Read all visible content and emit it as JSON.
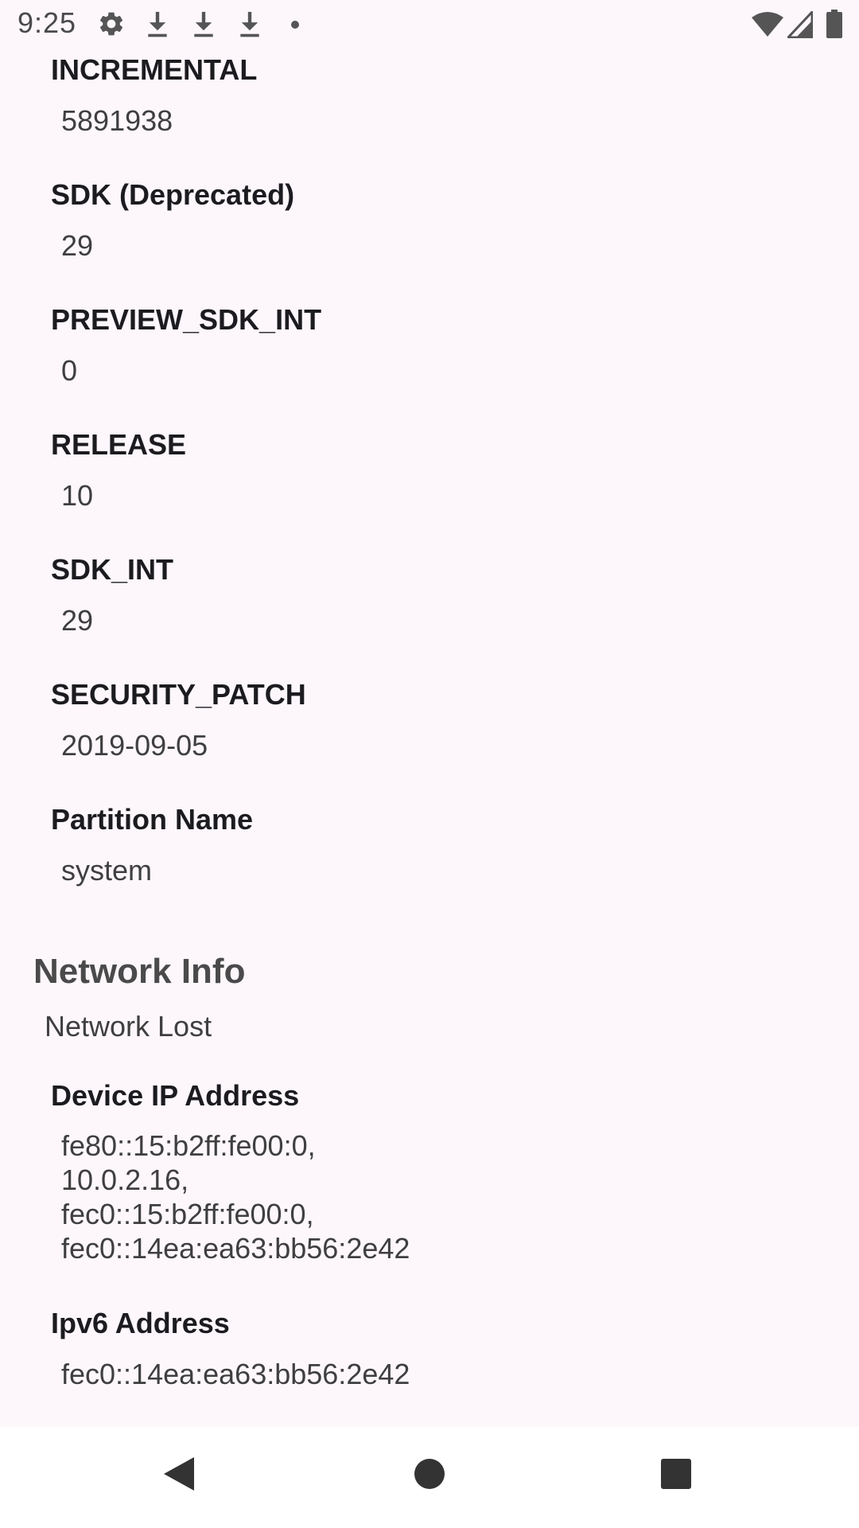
{
  "status_bar": {
    "time": "9:25",
    "left_icons": [
      "settings-icon",
      "download-icon",
      "download-icon",
      "download-icon",
      "dot-icon"
    ],
    "right_icons": [
      "wifi-icon",
      "cell-signal-icon",
      "battery-icon"
    ]
  },
  "build_info": [
    {
      "label": "INCREMENTAL",
      "value": "5891938"
    },
    {
      "label": "SDK (Deprecated)",
      "value": "29"
    },
    {
      "label": "PREVIEW_SDK_INT",
      "value": "0"
    },
    {
      "label": "RELEASE",
      "value": "10"
    },
    {
      "label": "SDK_INT",
      "value": "29"
    },
    {
      "label": "SECURITY_PATCH",
      "value": "2019-09-05"
    },
    {
      "label": "Partition Name",
      "value": "system"
    }
  ],
  "network": {
    "title": "Network Info",
    "status": "Network Lost",
    "ip_label": "Device IP Address",
    "ip_values": [
      "fe80::15:b2ff:fe00:0,",
      "10.0.2.16,",
      "fec0::15:b2ff:fe00:0,",
      "fec0::14ea:ea63:bb56:2e42"
    ],
    "ipv6_label": "Ipv6 Address",
    "ipv6_value": "fec0::14ea:ea63:bb56:2e42"
  },
  "nav_bar": {
    "buttons": [
      "back-icon",
      "home-icon",
      "recents-icon"
    ]
  },
  "colors": {
    "background": "#fdf7fc",
    "label": "#1c1b1f",
    "value": "#3f3f3f",
    "section_title": "#4a4a4a",
    "nav_background": "#ffffff"
  }
}
